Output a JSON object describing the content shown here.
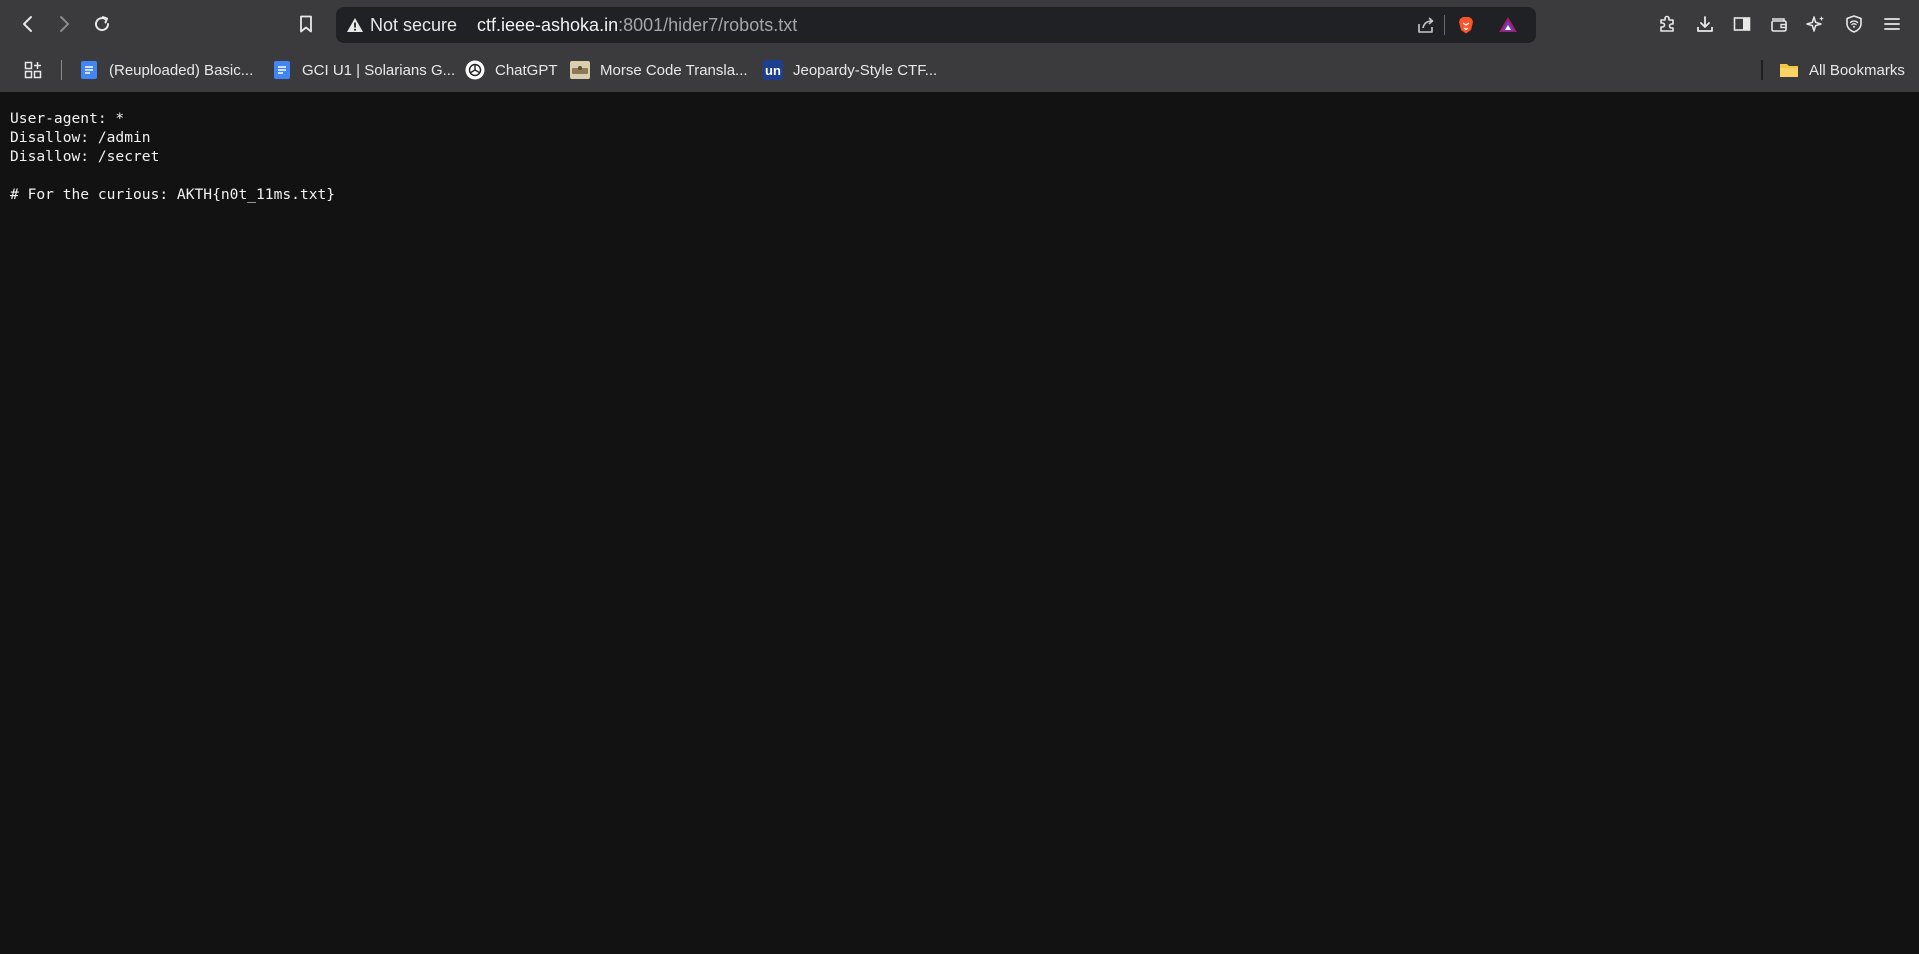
{
  "browser": {
    "security_label": "Not secure",
    "url_host": "ctf.ieee-ashoka.in",
    "url_rest": ":8001/hider7/robots.txt"
  },
  "bookmarks": [
    {
      "label": "(Reuploaded) Basic...",
      "icon": "docs-icon"
    },
    {
      "label": "GCI U1 | Solarians G...",
      "icon": "docs-icon"
    },
    {
      "label": "ChatGPT",
      "icon": "chatgpt-icon"
    },
    {
      "label": "Morse Code Transla...",
      "icon": "morse-icon"
    },
    {
      "label": "Jeopardy-Style CTF...",
      "icon": "un-icon"
    }
  ],
  "all_bookmarks_label": "All Bookmarks",
  "un_favicon_text": "un",
  "page": {
    "text": "User-agent: *\nDisallow: /admin\nDisallow: /secret\n\n# For the curious: AKTH{n0t_11ms.txt}"
  },
  "colors": {
    "toolbar": "#3b3b3d",
    "omnibox": "#202124",
    "page_bg": "#121212",
    "brave_orange": "#fb542b",
    "docs_blue": "#4285f4"
  }
}
